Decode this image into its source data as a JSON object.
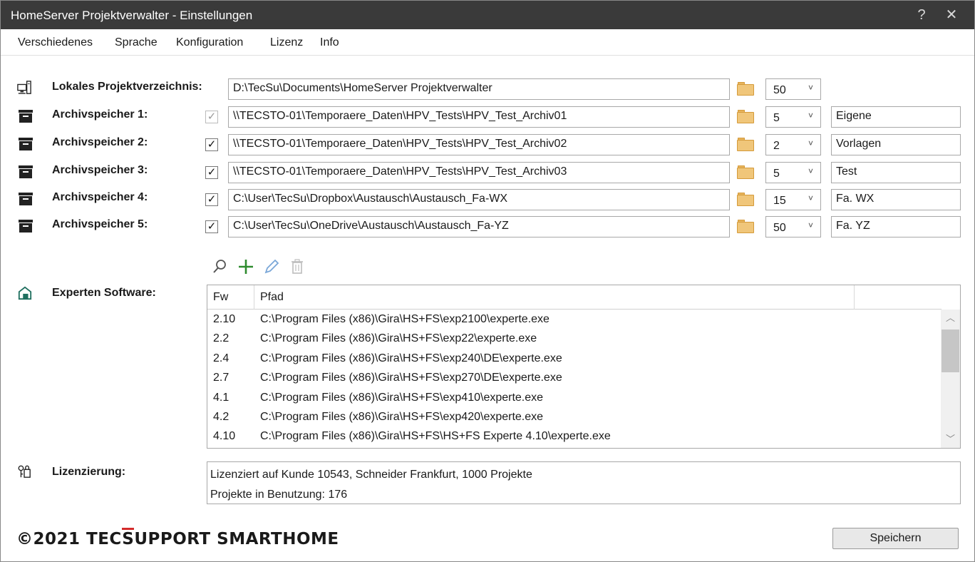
{
  "window": {
    "title": "HomeServer Projektverwalter - Einstellungen",
    "help_glyph": "?",
    "close_glyph": "✕"
  },
  "menu": {
    "items": [
      "Verschiedenes",
      "Sprache",
      "Konfiguration",
      "Lizenz",
      "Info"
    ]
  },
  "local_project_dir": {
    "label": "Lokales Projektverzeichnis:",
    "path": "D:\\TecSu\\Documents\\HomeServer Projektverwalter",
    "count": "50",
    "icon": "computer-network-icon"
  },
  "archives": [
    {
      "label": "Archivspeicher 1:",
      "checked": true,
      "enabled": false,
      "path": "\\\\TECSTO-01\\Temporaere_Daten\\HPV_Tests\\HPV_Test_Archiv01",
      "count": "5",
      "name": "Eigene"
    },
    {
      "label": "Archivspeicher 2:",
      "checked": true,
      "enabled": true,
      "path": "\\\\TECSTO-01\\Temporaere_Daten\\HPV_Tests\\HPV_Test_Archiv02",
      "count": "2",
      "name": "Vorlagen"
    },
    {
      "label": "Archivspeicher 3:",
      "checked": true,
      "enabled": true,
      "path": "\\\\TECSTO-01\\Temporaere_Daten\\HPV_Tests\\HPV_Test_Archiv03",
      "count": "5",
      "name": "Test"
    },
    {
      "label": "Archivspeicher 4:",
      "checked": true,
      "enabled": true,
      "path": "C:\\User\\TecSu\\Dropbox\\Austausch\\Austausch_Fa-WX",
      "count": "15",
      "name": "Fa. WX"
    },
    {
      "label": "Archivspeicher 5:",
      "checked": true,
      "enabled": true,
      "path": "C:\\User\\TecSu\\OneDrive\\Austausch\\Austausch_Fa-YZ",
      "count": "50",
      "name": "Fa. YZ"
    }
  ],
  "combo_arrow": "˅",
  "check_glyph": "✓",
  "expert_software": {
    "label": "Experten Software:",
    "toolbar_icons": [
      "search-icon",
      "add-icon",
      "edit-icon",
      "delete-icon"
    ],
    "columns": [
      "Fw",
      "Pfad"
    ],
    "rows": [
      {
        "fw": "2.10",
        "path": "C:\\Program Files (x86)\\Gira\\HS+FS\\exp2100\\experte.exe"
      },
      {
        "fw": "2.2",
        "path": "C:\\Program Files (x86)\\Gira\\HS+FS\\exp22\\experte.exe"
      },
      {
        "fw": "2.4",
        "path": "C:\\Program Files (x86)\\Gira\\HS+FS\\exp240\\DE\\experte.exe"
      },
      {
        "fw": "2.7",
        "path": "C:\\Program Files (x86)\\Gira\\HS+FS\\exp270\\DE\\experte.exe"
      },
      {
        "fw": "4.1",
        "path": "C:\\Program Files (x86)\\Gira\\HS+FS\\exp410\\experte.exe"
      },
      {
        "fw": "4.2",
        "path": "C:\\Program Files (x86)\\Gira\\HS+FS\\exp420\\experte.exe"
      },
      {
        "fw": "4.10",
        "path": "C:\\Program Files (x86)\\Gira\\HS+FS\\HS+FS Experte 4.10\\experte.exe"
      }
    ]
  },
  "licensing": {
    "label": "Lizenzierung:",
    "lines": [
      "Lizenziert auf Kunde 10543, Schneider Frankfurt, 1000 Projekte",
      "Projekte in Benutzung: 176"
    ]
  },
  "footer": {
    "brand_prefix": "©2021 TEC",
    "brand_accent": "S",
    "brand_suffix": "UPPORT SMARTHOME",
    "save_label": "Speichern"
  },
  "colors": {
    "titlebar": "#3a3a3a",
    "folder": "#f0c67a",
    "add_icon": "#2e8b2e",
    "edit_icon": "#7aa7d8",
    "brand_accent_bar": "#d32b2b"
  }
}
